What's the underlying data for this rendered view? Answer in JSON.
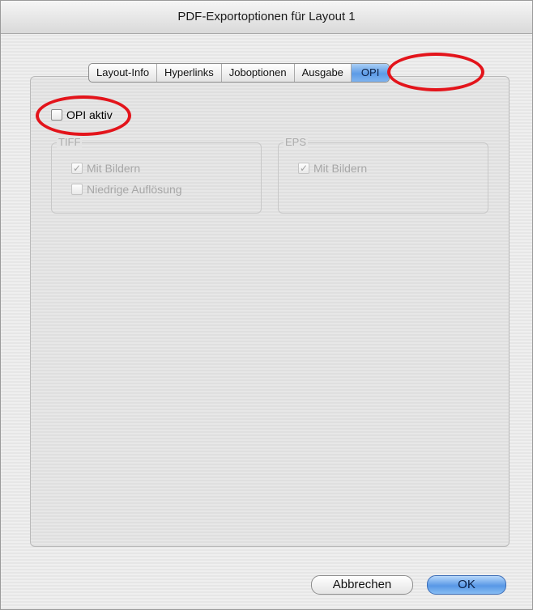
{
  "window": {
    "title": "PDF-Exportoptionen für Layout 1"
  },
  "tabs": [
    {
      "label": "Layout-Info"
    },
    {
      "label": "Hyperlinks"
    },
    {
      "label": "Joboptionen"
    },
    {
      "label": "Ausgabe"
    },
    {
      "label": "OPI",
      "selected": true
    }
  ],
  "opi": {
    "label": "OPI aktiv",
    "checked": false
  },
  "tiff": {
    "title": "TIFF",
    "mit_bildern": {
      "label": "Mit Bildern",
      "checked": true,
      "enabled": false
    },
    "niedrige_aufloesung": {
      "label": "Niedrige Auflösung",
      "checked": false,
      "enabled": false
    }
  },
  "eps": {
    "title": "EPS",
    "mit_bildern": {
      "label": "Mit Bildern",
      "checked": true,
      "enabled": false
    }
  },
  "buttons": {
    "cancel": "Abbrechen",
    "ok": "OK"
  },
  "colors": {
    "annotation_ring": "#e3141b",
    "accent": "#5d9be6"
  }
}
